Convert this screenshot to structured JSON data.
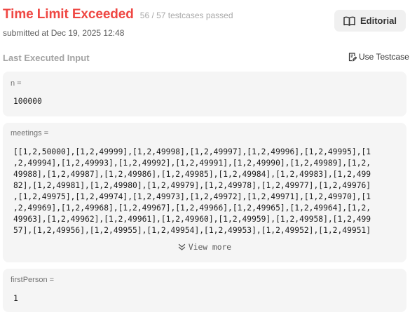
{
  "header": {
    "status": "Time Limit Exceeded",
    "cases_passed": "56 / 57 testcases passed",
    "submitted": "submitted at Dec 19, 2025 12:48",
    "editorial_label": "Editorial"
  },
  "section": {
    "title": "Last Executed Input",
    "use_testcase_label": "Use Testcase"
  },
  "inputs": {
    "n": {
      "label": "n =",
      "value": "100000"
    },
    "meetings": {
      "label": "meetings =",
      "lines": [
        "[[1,2,50000],[1,2,49999],[1,2,49998],[1,2,49997],[1,2,49996],[1,2,49995],[1",
        ",2,49994],[1,2,49993],[1,2,49992],[1,2,49991],[1,2,49990],[1,2,49989],[1,2,",
        "49988],[1,2,49987],[1,2,49986],[1,2,49985],[1,2,49984],[1,2,49983],[1,2,499",
        "82],[1,2,49981],[1,2,49980],[1,2,49979],[1,2,49978],[1,2,49977],[1,2,49976]",
        ",[1,2,49975],[1,2,49974],[1,2,49973],[1,2,49972],[1,2,49971],[1,2,49970],[1",
        ",2,49969],[1,2,49968],[1,2,49967],[1,2,49966],[1,2,49965],[1,2,49964],[1,2,",
        "49963],[1,2,49962],[1,2,49961],[1,2,49960],[1,2,49959],[1,2,49958],[1,2,499",
        "57],[1,2,49956],[1,2,49955],[1,2,49954],[1,2,49953],[1,2,49952],[1,2,49951]"
      ],
      "view_more_label": "View more"
    },
    "firstPerson": {
      "label": "firstPerson =",
      "value": "1"
    }
  },
  "colors": {
    "status_red": "#ef4743",
    "card_bg": "#f5f5f5",
    "muted_text": "#a3a3a3"
  },
  "icons": {
    "editorial": "open-book-icon",
    "use_testcase": "document-pencil-icon",
    "view_more": "double-chevron-down-icon"
  }
}
